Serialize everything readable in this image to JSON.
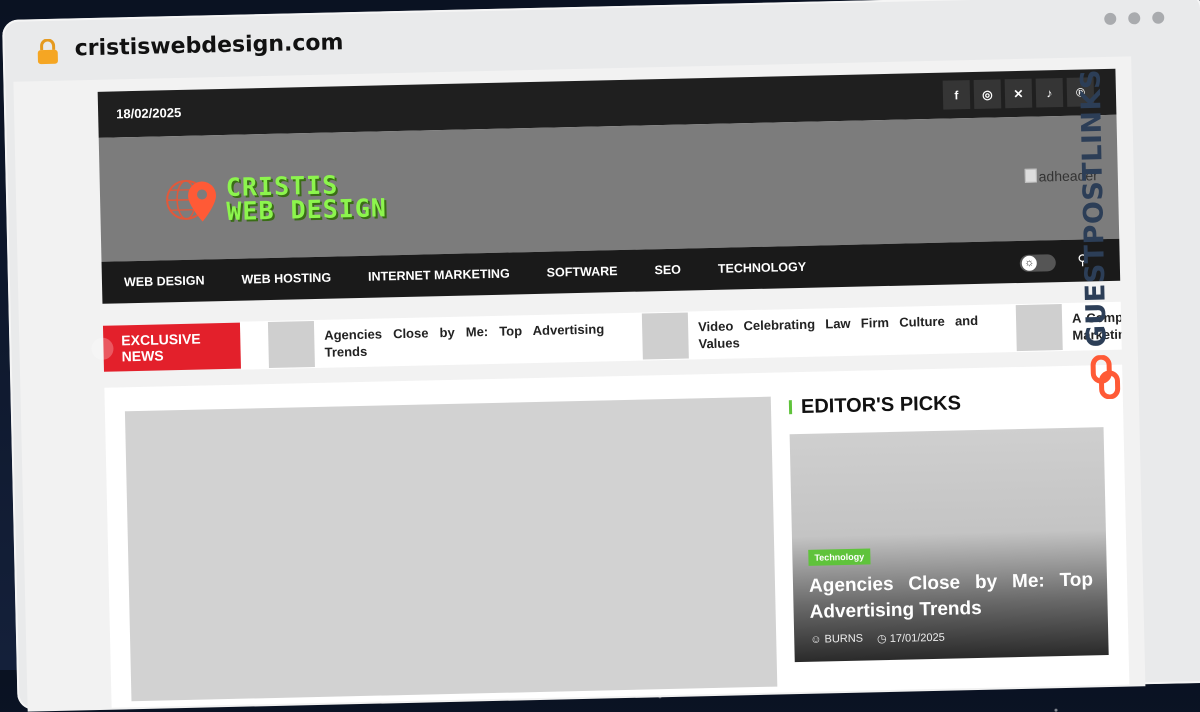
{
  "browser": {
    "url": "cristiswebdesign.com"
  },
  "side_brand": {
    "text": "GUESTPOSTLINKS"
  },
  "site": {
    "date": "18/02/2025",
    "socials": [
      "facebook-icon",
      "instagram-icon",
      "x-icon",
      "tiktok-icon",
      "pinterest-icon"
    ],
    "logo": {
      "line1": "CRISTIS",
      "line2": "WEB DESIGN"
    },
    "ad_alt": "adheader",
    "nav": [
      "WEB DESIGN",
      "WEB HOSTING",
      "INTERNET MARKETING",
      "SOFTWARE",
      "SEO",
      "TECHNOLOGY"
    ],
    "ticker": {
      "label": "EXCLUSIVE NEWS",
      "items": [
        "Agencies Close by Me: Top Advertising Trends",
        "Video Celebrating Law Firm Culture and Values",
        "A Complete Guide to Success with a Digital Marketing"
      ]
    },
    "editors_picks": {
      "title": "EDITOR'S PICKS",
      "card": {
        "category": "Technology",
        "title": "Agencies Close by Me: Top Advertising Trends",
        "author": "BURNS",
        "date": "17/01/2025"
      }
    }
  },
  "colors": {
    "accent_red": "#e3202b",
    "accent_green": "#5fc33b",
    "logo_green": "#8cf54d",
    "brand_orange": "#ff5a36"
  }
}
